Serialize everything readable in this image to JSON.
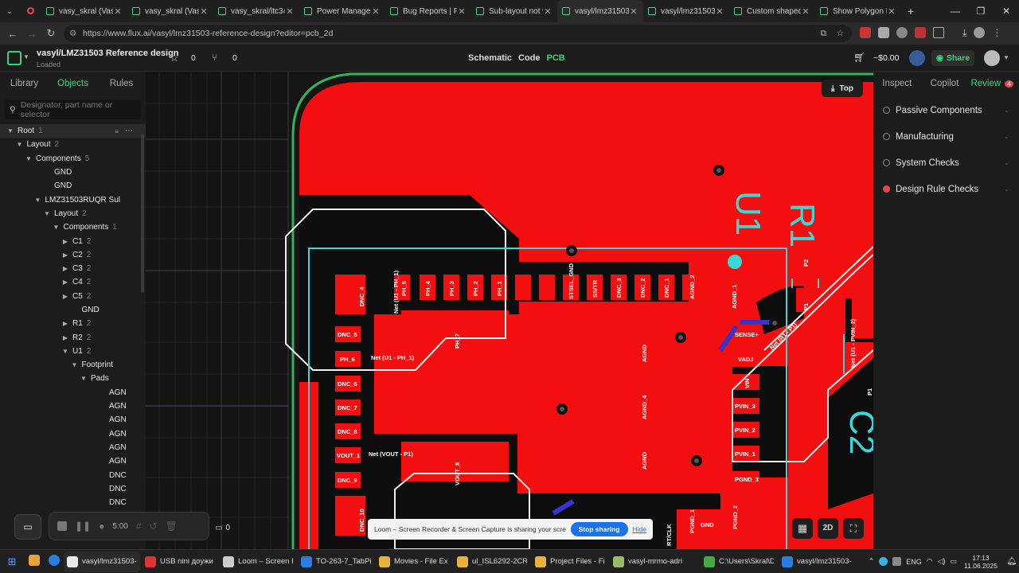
{
  "tabs": [
    {
      "title": "vasy_skral (Vasyl"
    },
    {
      "title": "vasy_skral (Vasyl"
    },
    {
      "title": "vasy_skral/ltc340"
    },
    {
      "title": "Power Managem"
    },
    {
      "title": "Bug Reports | Flu"
    },
    {
      "title": "Sub-layout not w"
    },
    {
      "title": "vasyl/lmz31503-"
    },
    {
      "title": "vasyl/lmz31503-"
    },
    {
      "title": "Custom shaped"
    },
    {
      "title": "Show Polygon L"
    }
  ],
  "browser": {
    "url": "https://www.flux.ai/vasyl/lmz31503-reference-design?editor=pcb_2d"
  },
  "app": {
    "project_title": "vasyl/LMZ31503 Reference design",
    "status": "Loaded",
    "star_count": "0",
    "fork_count": "0",
    "views": [
      "Schematic",
      "Code",
      "PCB"
    ],
    "active_view": "PCB",
    "cart": "~$0.00",
    "share_label": "Share"
  },
  "left_panel": {
    "tabs": [
      "Library",
      "Objects",
      "Rules"
    ],
    "active_tab": "Objects",
    "search_placeholder": "Designator, part name or selector",
    "tree": [
      {
        "label": "Root",
        "count": "1",
        "indent": 0,
        "chev": "open",
        "selected": true
      },
      {
        "label": "Layout",
        "count": "2",
        "indent": 1,
        "chev": "open"
      },
      {
        "label": "Components",
        "count": "5",
        "indent": 2,
        "chev": "open"
      },
      {
        "label": "GND",
        "count": "",
        "indent": 4,
        "chev": "none"
      },
      {
        "label": "GND",
        "count": "",
        "indent": 4,
        "chev": "none"
      },
      {
        "label": "LMZ31503RUQR Sul",
        "count": "",
        "indent": 3,
        "chev": "open"
      },
      {
        "label": "Layout",
        "count": "2",
        "indent": 4,
        "chev": "open"
      },
      {
        "label": "Components",
        "count": "1",
        "indent": 5,
        "chev": "open"
      },
      {
        "label": "C1",
        "count": "2",
        "indent": 6,
        "chev": "closed"
      },
      {
        "label": "C2",
        "count": "2",
        "indent": 6,
        "chev": "closed"
      },
      {
        "label": "C3",
        "count": "2",
        "indent": 6,
        "chev": "closed"
      },
      {
        "label": "C4",
        "count": "2",
        "indent": 6,
        "chev": "closed"
      },
      {
        "label": "C5",
        "count": "2",
        "indent": 6,
        "chev": "closed"
      },
      {
        "label": "GND",
        "count": "",
        "indent": 7,
        "chev": "none"
      },
      {
        "label": "R1",
        "count": "2",
        "indent": 6,
        "chev": "closed"
      },
      {
        "label": "R2",
        "count": "2",
        "indent": 6,
        "chev": "closed"
      },
      {
        "label": "U1",
        "count": "2",
        "indent": 6,
        "chev": "open"
      },
      {
        "label": "Footprint",
        "count": "",
        "indent": 7,
        "chev": "open"
      },
      {
        "label": "Pads",
        "count": "",
        "indent": 8,
        "chev": "open"
      },
      {
        "label": "AGN",
        "count": "",
        "indent": 10,
        "chev": "none"
      },
      {
        "label": "AGN",
        "count": "",
        "indent": 10,
        "chev": "none"
      },
      {
        "label": "AGN",
        "count": "",
        "indent": 10,
        "chev": "none"
      },
      {
        "label": "AGN",
        "count": "",
        "indent": 10,
        "chev": "none"
      },
      {
        "label": "AGN",
        "count": "",
        "indent": 10,
        "chev": "none"
      },
      {
        "label": "AGN",
        "count": "",
        "indent": 10,
        "chev": "none"
      },
      {
        "label": "DNC",
        "count": "",
        "indent": 10,
        "chev": "none"
      },
      {
        "label": "DNC",
        "count": "",
        "indent": 10,
        "chev": "none"
      },
      {
        "label": "DNC",
        "count": "",
        "indent": 10,
        "chev": "none"
      }
    ],
    "tree_tail": "DNC"
  },
  "right_panel": {
    "tabs": [
      "Inspect",
      "Copilot",
      "Review"
    ],
    "active_tab": "Review",
    "review_badge": "4",
    "items": [
      {
        "label": "Passive Components",
        "error": false
      },
      {
        "label": "Manufacturing",
        "error": false
      },
      {
        "label": "System Checks",
        "error": false
      },
      {
        "label": "Design Rule Checks",
        "error": true
      }
    ]
  },
  "canvas": {
    "layer_button": "Top",
    "view_mode": "2D",
    "timer": "5:00",
    "comments": "0",
    "labels": {
      "u1": "U1",
      "r1": "R1",
      "c2": "C2",
      "dnc_4": "DNC_4",
      "dnc_5": "DNC_5",
      "ph_6": "PH_6",
      "dnc_6": "DNC_6",
      "dnc_7": "DNC_7",
      "dnc_8": "DNC_8",
      "vout_1": "VOUT_1",
      "dnc_9": "DNC_9",
      "dnc_10": "DNC_10",
      "ph_5": "PH_5",
      "ph_4": "PH_4",
      "ph_3": "PH_3",
      "ph_2": "PH_2",
      "ph_1": "PH_1",
      "stsel_gnd": "STSEL_GND",
      "ss_tr": "SS/TR",
      "dnc_3": "DNC_3",
      "dnc_2": "DNC_2",
      "dnc_1": "DNC_1",
      "agnd_2": "AGND_2",
      "agnd_1": "AGND_1",
      "sense": "SENSE+",
      "vadj": "VADJ",
      "vin": "VIN",
      "pvin_3": "PVIN_3",
      "pvin_2": "PVIN_2",
      "pvin_1": "PVIN_1",
      "pgnd_3": "PGND_3",
      "pgnd_2": "PGND_2",
      "pgnd_1": "PGND_1",
      "gnd": "GND",
      "agnd_a": "AGND",
      "agnd_4": "AGND_4",
      "agnd_b": "AGND",
      "ph_7": "PH_7",
      "vout_8": "VOUT_8",
      "p1": "P1",
      "p2": "P2",
      "p1b": "P1",
      "net_ph1": "Net (U1 - PH_1)",
      "net_ph1b": "Net (U1 - PH_1)",
      "net_vout": "Net (VOUT - P1)",
      "net_r1": "Net (R1 - P1)",
      "net_pvin": "Net (U1 - PVIN_2)",
      "rt_clk": "RT/CLK"
    }
  },
  "loom_bar": {
    "message": "Loom – Screen Recorder & Screen Capture is sharing your screen.",
    "stop": "Stop sharing",
    "hide": "Hide"
  },
  "taskbar": {
    "items": [
      "vasyl/lmz31503-r",
      "USB nini доужи",
      "Loom – Screen R",
      "TO-263-7_TabPir",
      "Movies - File Ex",
      "ul_ISL6292-2CR3",
      "Project Files - Fil",
      "vasyl-mrmo-adri",
      "C:\\Users\\Skral\\Di",
      "vasyl/lmz31503-r"
    ],
    "lang": "ENG",
    "time": "17:13",
    "date": "11.06.2025"
  }
}
